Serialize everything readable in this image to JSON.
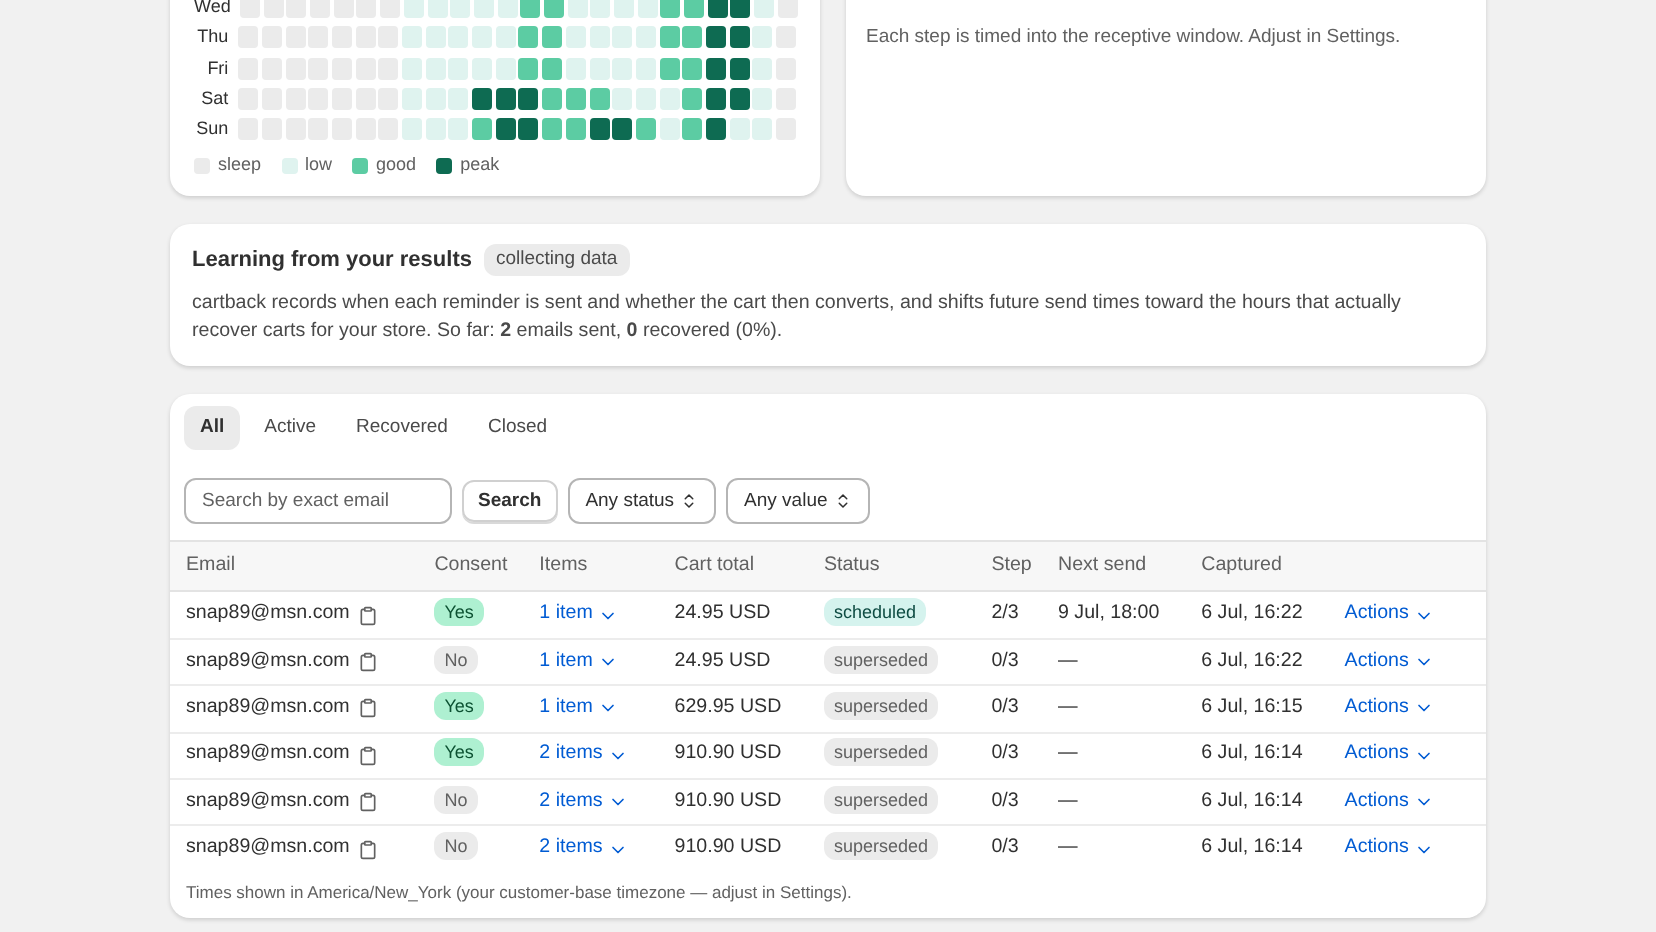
{
  "heatmap": {
    "rows": [
      {
        "day": "Wed",
        "cells": [
          {
            "kind": "sleep"
          },
          {
            "kind": "sleep"
          },
          {
            "kind": "sleep"
          },
          {
            "kind": "sleep"
          },
          {
            "kind": "sleep"
          },
          {
            "kind": "sleep"
          },
          {
            "kind": "sleep"
          },
          {
            "kind": "low"
          },
          {
            "kind": "low"
          },
          {
            "kind": "low"
          },
          {
            "kind": "low"
          },
          {
            "kind": "low"
          },
          {
            "kind": "good"
          },
          {
            "kind": "good"
          },
          {
            "kind": "low"
          },
          {
            "kind": "low"
          },
          {
            "kind": "low"
          },
          {
            "kind": "low"
          },
          {
            "kind": "good"
          },
          {
            "kind": "good"
          },
          {
            "kind": "peak"
          },
          {
            "kind": "peak"
          },
          {
            "kind": "low"
          },
          {
            "kind": "sleep"
          }
        ]
      },
      {
        "day": "Thu",
        "cells": [
          {
            "kind": "sleep"
          },
          {
            "kind": "sleep"
          },
          {
            "kind": "sleep"
          },
          {
            "kind": "sleep"
          },
          {
            "kind": "sleep"
          },
          {
            "kind": "sleep"
          },
          {
            "kind": "sleep"
          },
          {
            "kind": "low"
          },
          {
            "kind": "low"
          },
          {
            "kind": "low"
          },
          {
            "kind": "low"
          },
          {
            "kind": "low"
          },
          {
            "kind": "good"
          },
          {
            "kind": "good"
          },
          {
            "kind": "low"
          },
          {
            "kind": "low"
          },
          {
            "kind": "low"
          },
          {
            "kind": "low"
          },
          {
            "kind": "good"
          },
          {
            "kind": "good"
          },
          {
            "kind": "peak"
          },
          {
            "kind": "peak"
          },
          {
            "kind": "low"
          },
          {
            "kind": "sleep"
          }
        ]
      },
      {
        "day": "Fri",
        "cells": [
          {
            "kind": "sleep"
          },
          {
            "kind": "sleep"
          },
          {
            "kind": "sleep"
          },
          {
            "kind": "sleep"
          },
          {
            "kind": "sleep"
          },
          {
            "kind": "sleep"
          },
          {
            "kind": "sleep"
          },
          {
            "kind": "low"
          },
          {
            "kind": "low"
          },
          {
            "kind": "low"
          },
          {
            "kind": "low"
          },
          {
            "kind": "low"
          },
          {
            "kind": "good"
          },
          {
            "kind": "good"
          },
          {
            "kind": "low"
          },
          {
            "kind": "low"
          },
          {
            "kind": "low"
          },
          {
            "kind": "low"
          },
          {
            "kind": "good"
          },
          {
            "kind": "good"
          },
          {
            "kind": "peak"
          },
          {
            "kind": "peak"
          },
          {
            "kind": "low"
          },
          {
            "kind": "sleep"
          }
        ]
      },
      {
        "day": "Sat",
        "cells": [
          {
            "kind": "sleep"
          },
          {
            "kind": "sleep"
          },
          {
            "kind": "sleep"
          },
          {
            "kind": "sleep"
          },
          {
            "kind": "sleep"
          },
          {
            "kind": "sleep"
          },
          {
            "kind": "sleep"
          },
          {
            "kind": "low"
          },
          {
            "kind": "low"
          },
          {
            "kind": "low"
          },
          {
            "kind": "peak"
          },
          {
            "kind": "peak"
          },
          {
            "kind": "peak"
          },
          {
            "kind": "good"
          },
          {
            "kind": "good"
          },
          {
            "kind": "good"
          },
          {
            "kind": "low"
          },
          {
            "kind": "low"
          },
          {
            "kind": "low"
          },
          {
            "kind": "good"
          },
          {
            "kind": "peak"
          },
          {
            "kind": "peak"
          },
          {
            "kind": "low"
          },
          {
            "kind": "sleep"
          }
        ]
      },
      {
        "day": "Sun",
        "cells": [
          {
            "kind": "sleep"
          },
          {
            "kind": "sleep"
          },
          {
            "kind": "sleep"
          },
          {
            "kind": "sleep"
          },
          {
            "kind": "sleep"
          },
          {
            "kind": "sleep"
          },
          {
            "kind": "sleep"
          },
          {
            "kind": "low"
          },
          {
            "kind": "low"
          },
          {
            "kind": "low"
          },
          {
            "kind": "good"
          },
          {
            "kind": "peak"
          },
          {
            "kind": "peak"
          },
          {
            "kind": "good"
          },
          {
            "kind": "good"
          },
          {
            "kind": "peak"
          },
          {
            "kind": "peak"
          },
          {
            "kind": "good"
          },
          {
            "kind": "low"
          },
          {
            "kind": "good"
          },
          {
            "kind": "peak"
          },
          {
            "kind": "low"
          },
          {
            "kind": "low"
          },
          {
            "kind": "sleep"
          }
        ]
      }
    ],
    "legend": [
      {
        "kind": "sleep",
        "label": "sleep"
      },
      {
        "kind": "low",
        "label": "low"
      },
      {
        "kind": "good",
        "label": "good"
      },
      {
        "kind": "peak",
        "label": "peak"
      }
    ]
  },
  "timing_note": "Each step is timed into the receptive window. Adjust in Settings.",
  "learning": {
    "title": "Learning from your results",
    "badge": "collecting data",
    "text": "cartback records when each reminder is sent and whether the cart then converts, and shifts future send times toward the hours that actually recover carts for your store. So far: **2** emails sent, **0** recovered (0%)."
  },
  "tabs": [
    {
      "label": "All",
      "selected": true
    },
    {
      "label": "Active",
      "selected": false
    },
    {
      "label": "Recovered",
      "selected": false
    },
    {
      "label": "Closed",
      "selected": false
    }
  ],
  "search": {
    "placeholder": "Search by exact email",
    "button": "Search"
  },
  "filters": [
    "Any status",
    "Any value"
  ],
  "table": {
    "columns": [
      "Email",
      "Consent",
      "Items",
      "Cart total",
      "Status",
      "Step",
      "Next send",
      "Captured"
    ],
    "rows": [
      {
        "email": "snap89@msn.com",
        "consent": "Yes",
        "consented": true,
        "items": "1 item",
        "total": "24.95 USD",
        "status": "scheduled",
        "scheduled": true,
        "step": "2/3",
        "next": "9 Jul, 18:00",
        "captured": "6 Jul, 16:22",
        "action": "Actions"
      },
      {
        "email": "snap89@msn.com",
        "consent": "No",
        "consented": false,
        "items": "1 item",
        "total": "24.95 USD",
        "status": "superseded",
        "scheduled": false,
        "step": "0/3",
        "next": "—",
        "captured": "6 Jul, 16:22",
        "action": "Actions"
      },
      {
        "email": "snap89@msn.com",
        "consent": "Yes",
        "consented": true,
        "items": "1 item",
        "total": "629.95 USD",
        "status": "superseded",
        "scheduled": false,
        "step": "0/3",
        "next": "—",
        "captured": "6 Jul, 16:15",
        "action": "Actions"
      },
      {
        "email": "snap89@msn.com",
        "consent": "Yes",
        "consented": true,
        "items": "2 items",
        "total": "910.90 USD",
        "status": "superseded",
        "scheduled": false,
        "step": "0/3",
        "next": "—",
        "captured": "6 Jul, 16:14",
        "action": "Actions"
      },
      {
        "email": "snap89@msn.com",
        "consent": "No",
        "consented": false,
        "items": "2 items",
        "total": "910.90 USD",
        "status": "superseded",
        "scheduled": false,
        "step": "0/3",
        "next": "—",
        "captured": "6 Jul, 16:14",
        "action": "Actions"
      },
      {
        "email": "snap89@msn.com",
        "consent": "No",
        "consented": false,
        "items": "2 items",
        "total": "910.90 USD",
        "status": "superseded",
        "scheduled": false,
        "step": "0/3",
        "next": "—",
        "captured": "6 Jul, 16:14",
        "action": "Actions"
      }
    ]
  },
  "footnote": "Times shown in America/New_York (your customer-base timezone — adjust in Settings)."
}
